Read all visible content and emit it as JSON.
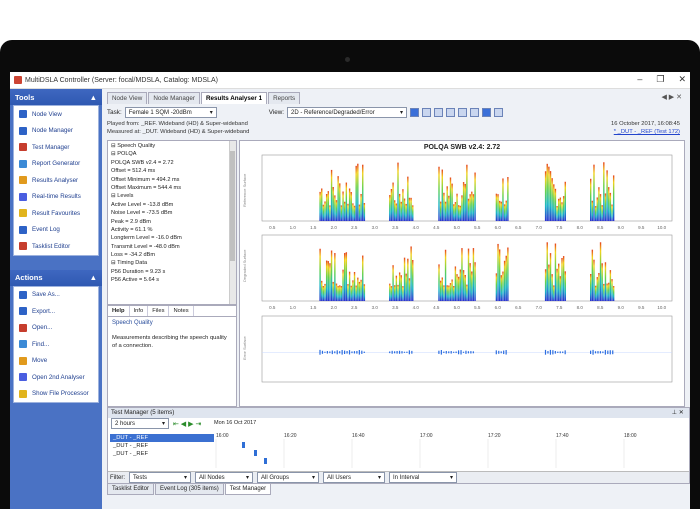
{
  "window": {
    "title": "MultiDSLA Controller (Server: focal/MDSLA, Catalog: MDSLA)"
  },
  "colors": {
    "sidebar": "#4a72c4",
    "accent": "#3b70d1"
  },
  "tools": {
    "header": "Tools",
    "items": [
      {
        "label": "Node View",
        "icon": "node-view-icon"
      },
      {
        "label": "Node Manager",
        "icon": "node-manager-icon"
      },
      {
        "label": "Test Manager",
        "icon": "test-manager-icon"
      },
      {
        "label": "Report Generator",
        "icon": "report-icon"
      },
      {
        "label": "Results Analyser",
        "icon": "results-analyser-icon"
      },
      {
        "label": "Real-time Results",
        "icon": "realtime-results-icon"
      },
      {
        "label": "Result Favourites",
        "icon": "star-icon"
      },
      {
        "label": "Event Log",
        "icon": "event-log-icon"
      },
      {
        "label": "Tasklist Editor",
        "icon": "tasklist-icon"
      }
    ]
  },
  "actions": {
    "header": "Actions",
    "items": [
      {
        "label": "Save As...",
        "icon": "save-icon"
      },
      {
        "label": "Export...",
        "icon": "export-icon"
      },
      {
        "label": "Open...",
        "icon": "open-icon"
      },
      {
        "label": "Find...",
        "icon": "find-icon"
      },
      {
        "label": "Move",
        "icon": "move-icon"
      },
      {
        "label": "Open 2nd Analyser",
        "icon": "analyser-icon"
      },
      {
        "label": "Show File Processor",
        "icon": "file-processor-icon"
      }
    ]
  },
  "tabs": [
    "Node View",
    "Node Manager",
    "Results Analyser 1",
    "Reports"
  ],
  "toolbar": {
    "task_label": "Task:",
    "task_value": "Female 1 SQM -20dBm",
    "view_label": "View:",
    "view_value": "2D - Reference/Degraded/Error"
  },
  "info": {
    "line1": "Played from: _REF. Wideband (HD) & Super-wideband",
    "line2": "Measured at: _DUT. Wideband (HD) & Super-wideband",
    "date": "16 October 2017, 16:08:45",
    "link": "* _DUT - _REF (Test 172)"
  },
  "tree": [
    "⊟ Speech Quality",
    "   ⊟ POLQA",
    "        POLQA SWB v2.4 = 2.72",
    "        Offset = 512.4 ms",
    "        Offset Minimum = 494.2 ms",
    "        Offset Maximum = 544.4 ms",
    "⊟ Levels",
    "        Active Level = -13.8 dBm",
    "        Noise Level = -73.5 dBm",
    "        Peak = 2.9 dBm",
    "        Activity = 61.1 %",
    "        Longterm Level = -16.0 dBm",
    "        Transmit Level = -48.0 dBm",
    "        Loss = -34.2 dBm",
    "⊟ Timing Data",
    "        P56 Duration = 9.23 s",
    "        P56 Active = 5.64 s"
  ],
  "help": {
    "tabs": [
      "Help",
      "Info",
      "Files",
      "Notes"
    ],
    "title": "Speech Quality",
    "desc": "Measurements describing the speech quality of a connection."
  },
  "chart_title": "POLQA SWB v2.4: 2.72",
  "panel_labels": [
    "Reference Surface",
    "Degraded Surface",
    "Error Surface"
  ],
  "x_ticks": [
    "0.5",
    "1.0",
    "1.5",
    "2.0",
    "2.5",
    "3.0",
    "3.5",
    "4.0",
    "4.5",
    "5.0",
    "5.5",
    "6.0",
    "6.5",
    "7.0",
    "7.5",
    "8.0",
    "8.5",
    "9.0",
    "9.5",
    "10.0"
  ],
  "test_manager": {
    "header": "Test Manager (5 items)",
    "range": "2 hours",
    "date_label": "Mon 16 Oct 2017",
    "times": [
      "16:00",
      "16:20",
      "16:40",
      "17:00",
      "17:20",
      "17:40",
      "18:00"
    ],
    "items": [
      "_DUT - _REF",
      "_DUT - _REF",
      "_DUT - _REF"
    ],
    "filter_label": "Filter:",
    "filters": [
      "Tests",
      "All Nodes",
      "All Groups",
      "All Users",
      "In Interval"
    ]
  },
  "bottom_tabs": [
    "Tasklist Editor",
    "Event Log (305 items)",
    "Test Manager"
  ]
}
